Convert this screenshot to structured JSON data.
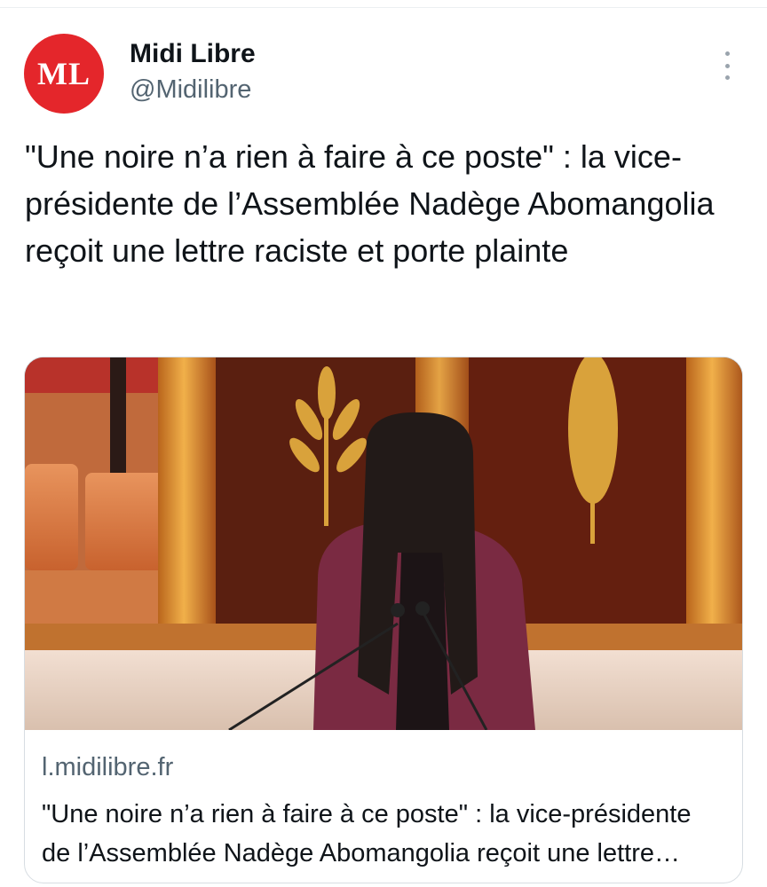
{
  "author": {
    "avatar_initials": "ML",
    "name": "Midi Libre",
    "handle": "@Midilibre"
  },
  "tweet": {
    "text": "\"Une noire n’a rien à faire à ce poste\" : la vice-présidente de l’Assemblée Nadège Abomangolia reçoit une lettre raciste et porte plainte"
  },
  "link_card": {
    "domain": "l.midilibre.fr",
    "title": "\"Une noire n’a rien à faire à ce poste\" : la vice-présidente de l’Assemblée Nadège Abomangolia reçoit une lettre raciste et porte plainte"
  },
  "icons": {
    "more": "more-vertical-icon"
  },
  "colors": {
    "avatar_bg": "#e4262b",
    "text_primary": "#0f1419",
    "text_secondary": "#536471",
    "border": "#d7dde2"
  }
}
